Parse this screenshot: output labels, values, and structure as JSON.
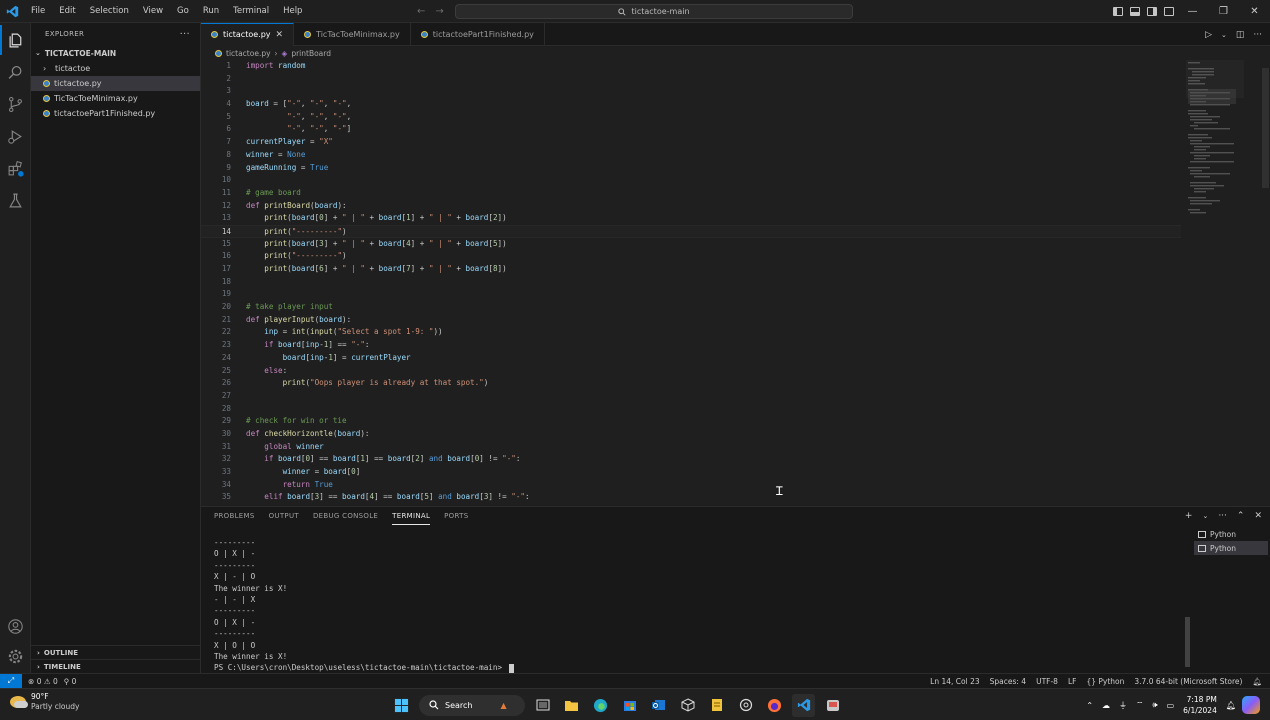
{
  "menu": [
    "File",
    "Edit",
    "Selection",
    "View",
    "Go",
    "Run",
    "Terminal",
    "Help"
  ],
  "command_center": {
    "label": "tictactoe-main"
  },
  "sidebar": {
    "title": "EXPLORER",
    "folder": "TICTACTOE-MAIN",
    "items": [
      {
        "label": "tictactoe",
        "kind": "folder"
      },
      {
        "label": "tictactoe.py",
        "kind": "python",
        "selected": true
      },
      {
        "label": "TicTacToeMinimax.py",
        "kind": "python"
      },
      {
        "label": "tictactoePart1Finished.py",
        "kind": "python"
      }
    ],
    "outline": "OUTLINE",
    "timeline": "TIMELINE"
  },
  "tabs": [
    {
      "label": "tictactoe.py",
      "active": true
    },
    {
      "label": "TicTacToeMinimax.py",
      "active": false
    },
    {
      "label": "tictactoePart1Finished.py",
      "active": false
    }
  ],
  "breadcrumb": {
    "file": "tictactoe.py",
    "symbol": "printBoard"
  },
  "editor": {
    "current_line": 14,
    "lines": [
      {
        "n": "1",
        "code": "import random"
      },
      {
        "n": "2",
        "code": ""
      },
      {
        "n": "3",
        "code": ""
      },
      {
        "n": "4",
        "code": "board = [\"-\", \"-\", \"-\","
      },
      {
        "n": "5",
        "code": "         \"-\", \"-\", \"-\","
      },
      {
        "n": "6",
        "code": "         \"-\", \"-\", \"-\"]"
      },
      {
        "n": "7",
        "code": "currentPlayer = \"X\""
      },
      {
        "n": "8",
        "code": "winner = None"
      },
      {
        "n": "9",
        "code": "gameRunning = True"
      },
      {
        "n": "10",
        "code": ""
      },
      {
        "n": "11",
        "code": "# game board"
      },
      {
        "n": "12",
        "code": "def printBoard(board):"
      },
      {
        "n": "13",
        "code": "    print(board[0] + \" | \" + board[1] + \" | \" + board[2])"
      },
      {
        "n": "14",
        "code": "    print(\"---------\")"
      },
      {
        "n": "15",
        "code": "    print(board[3] + \" | \" + board[4] + \" | \" + board[5])"
      },
      {
        "n": "16",
        "code": "    print(\"---------\")"
      },
      {
        "n": "17",
        "code": "    print(board[6] + \" | \" + board[7] + \" | \" + board[8])"
      },
      {
        "n": "18",
        "code": ""
      },
      {
        "n": "19",
        "code": ""
      },
      {
        "n": "20",
        "code": "# take player input"
      },
      {
        "n": "21",
        "code": "def playerInput(board):"
      },
      {
        "n": "22",
        "code": "    inp = int(input(\"Select a spot 1-9: \"))"
      },
      {
        "n": "23",
        "code": "    if board[inp-1] == \"-\":"
      },
      {
        "n": "24",
        "code": "        board[inp-1] = currentPlayer"
      },
      {
        "n": "25",
        "code": "    else:"
      },
      {
        "n": "26",
        "code": "        print(\"Oops player is already at that spot.\")"
      },
      {
        "n": "27",
        "code": ""
      },
      {
        "n": "28",
        "code": ""
      },
      {
        "n": "29",
        "code": "# check for win or tie"
      },
      {
        "n": "30",
        "code": "def checkHorizontle(board):"
      },
      {
        "n": "31",
        "code": "    global winner"
      },
      {
        "n": "32",
        "code": "    if board[0] == board[1] == board[2] and board[0] != \"-\":"
      },
      {
        "n": "33",
        "code": "        winner = board[0]"
      },
      {
        "n": "34",
        "code": "        return True"
      },
      {
        "n": "35",
        "code": "    elif board[3] == board[4] == board[5] and board[3] != \"-\":"
      }
    ]
  },
  "panel": {
    "tabs": [
      "PROBLEMS",
      "OUTPUT",
      "DEBUG CONSOLE",
      "TERMINAL",
      "PORTS"
    ],
    "active_tab": "TERMINAL",
    "terminal_lines": [
      "---------",
      "O | X | -",
      "---------",
      "X | - | O",
      "The winner is X!",
      "- | - | X",
      "---------",
      "O | X | -",
      "---------",
      "X | O | O",
      "The winner is X!"
    ],
    "prompt": "PS C:\\Users\\cron\\Desktop\\useless\\tictactoe-main\\tictactoe-main> ",
    "terminals": [
      {
        "label": "Python",
        "active": false
      },
      {
        "label": "Python",
        "active": true
      }
    ]
  },
  "statusbar": {
    "errors": "0",
    "warnings": "0",
    "ports": "0",
    "position": "Ln 14, Col 23",
    "spaces": "Spaces: 4",
    "encoding": "UTF-8",
    "eol": "LF",
    "language": "Python",
    "interpreter": "3.7.0 64-bit (Microsoft Store)"
  },
  "taskbar": {
    "weather_temp": "90°F",
    "weather_desc": "Partly cloudy",
    "search_label": "Search",
    "time": "7:18 PM",
    "date": "6/1/2024"
  },
  "colors": {
    "accent": "#0078d4",
    "editor_bg": "#1f1f1f",
    "keyword": "#c586c0",
    "string": "#ce9178",
    "comment": "#6a9955"
  }
}
